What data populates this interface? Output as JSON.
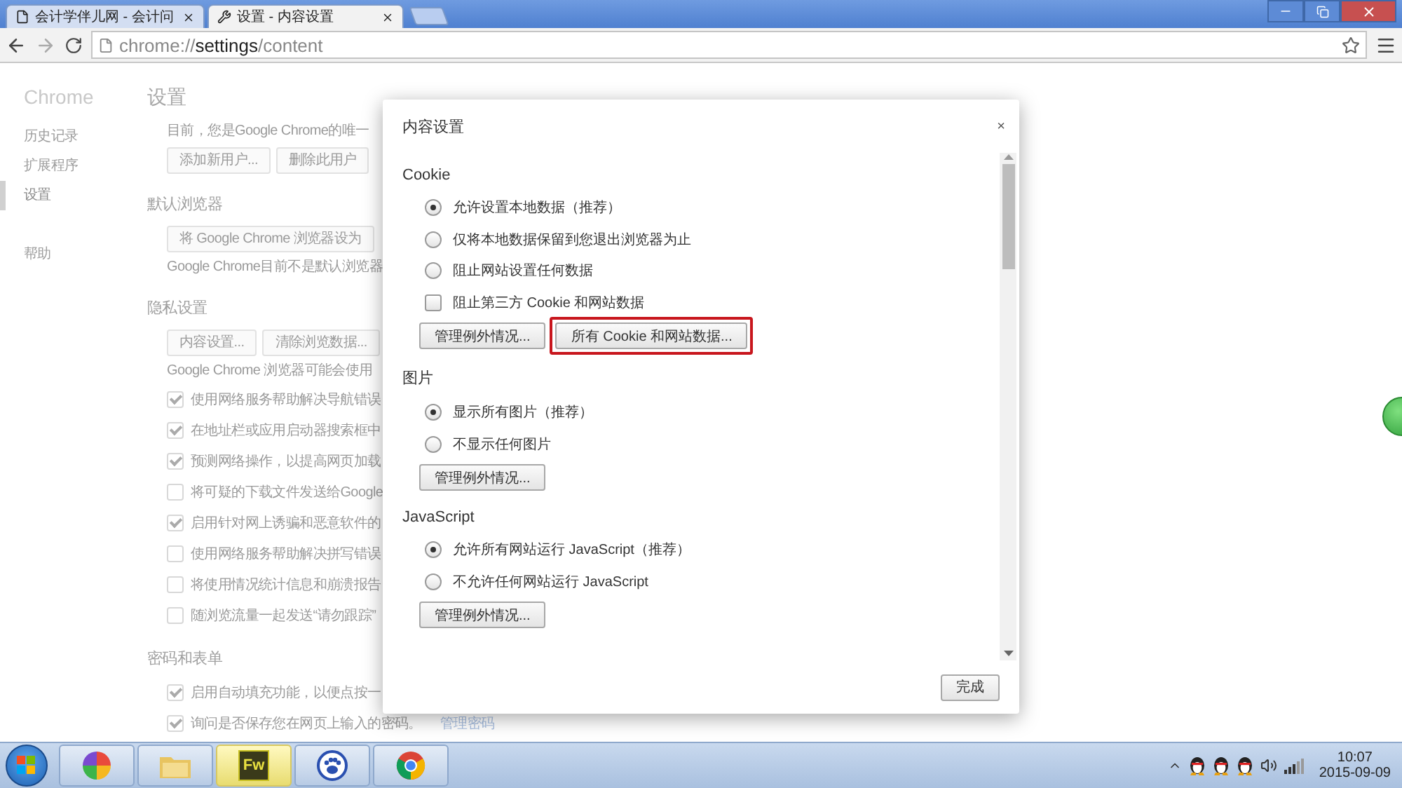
{
  "browser": {
    "tabs": [
      {
        "title": "会计学伴儿网 - 会计问",
        "selected": false,
        "kind": "page"
      },
      {
        "title": "设置 - 内容设置",
        "selected": true,
        "kind": "settings"
      }
    ],
    "address": {
      "scheme": "chrome://",
      "host": "settings",
      "path": "/content"
    }
  },
  "settings_page": {
    "sidebar": {
      "title": "Chrome",
      "groups": [
        [
          {
            "label": "历史记录",
            "selected": false
          },
          {
            "label": "扩展程序",
            "selected": false
          },
          {
            "label": "设置",
            "selected": true
          }
        ],
        [
          {
            "label": "帮助",
            "selected": false
          }
        ]
      ]
    },
    "heading": "设置",
    "sections": [
      {
        "items": [
          {
            "kind": "text",
            "text": "目前，您是Google Chrome的唯一"
          },
          {
            "kind": "buttons",
            "labels": [
              "添加新用户...",
              "删除此用户"
            ]
          }
        ]
      },
      {
        "title": "默认浏览器",
        "items": [
          {
            "kind": "buttons",
            "labels": [
              "将 Google Chrome 浏览器设为"
            ]
          },
          {
            "kind": "text",
            "text": "Google Chrome目前不是默认浏览器"
          }
        ]
      },
      {
        "title": "隐私设置",
        "items": [
          {
            "kind": "buttons",
            "labels": [
              "内容设置...",
              "清除浏览数据..."
            ]
          },
          {
            "kind": "text",
            "text": "Google Chrome 浏览器可能会使用"
          },
          {
            "kind": "checkbox",
            "label": "使用网络服务帮助解决导航错误",
            "checked": true
          },
          {
            "kind": "checkbox",
            "label": "在地址栏或应用启动器搜索框中",
            "checked": true
          },
          {
            "kind": "checkbox",
            "label": "预测网络操作，以提高网页加载",
            "checked": true
          },
          {
            "kind": "checkbox",
            "label": "将可疑的下载文件发送给Google",
            "checked": false
          },
          {
            "kind": "checkbox",
            "label": "启用针对网上诱骗和恶意软件的",
            "checked": true
          },
          {
            "kind": "checkbox",
            "label": "使用网络服务帮助解决拼写错误",
            "checked": false
          },
          {
            "kind": "checkbox",
            "label": "将使用情况统计信息和崩溃报告",
            "checked": false
          },
          {
            "kind": "checkbox",
            "label": "随浏览流量一起发送“请勿跟踪”",
            "checked": false
          }
        ]
      },
      {
        "title": "密码和表单",
        "items": [
          {
            "kind": "checkbox",
            "label": "启用自动填充功能，以便点按一",
            "checked": true
          },
          {
            "kind": "checkbox",
            "label": "询问是否保存您在网页上输入的密码。",
            "checked": true,
            "link": "管理密码"
          }
        ]
      }
    ]
  },
  "dialog": {
    "title": "内容设置",
    "close": "×",
    "sections": [
      {
        "title": "Cookie",
        "items": [
          {
            "kind": "radio",
            "label": "允许设置本地数据（推荐）",
            "selected": true
          },
          {
            "kind": "radio",
            "label": "仅将本地数据保留到您退出浏览器为止",
            "selected": false
          },
          {
            "kind": "radio",
            "label": "阻止网站设置任何数据",
            "selected": false
          },
          {
            "kind": "checkbox",
            "label": "阻止第三方 Cookie 和网站数据",
            "checked": false
          },
          {
            "kind": "buttons",
            "buttons": [
              {
                "label": "管理例外情况...",
                "highlighted": false
              },
              {
                "label": "所有 Cookie 和网站数据...",
                "highlighted": true
              }
            ]
          }
        ]
      },
      {
        "title": "图片",
        "items": [
          {
            "kind": "radio",
            "label": "显示所有图片（推荐）",
            "selected": true
          },
          {
            "kind": "radio",
            "label": "不显示任何图片",
            "selected": false
          },
          {
            "kind": "buttons",
            "buttons": [
              {
                "label": "管理例外情况...",
                "highlighted": false
              }
            ]
          }
        ]
      },
      {
        "title": "JavaScript",
        "items": [
          {
            "kind": "radio",
            "label": "允许所有网站运行 JavaScript（推荐）",
            "selected": true
          },
          {
            "kind": "radio",
            "label": "不允许任何网站运行 JavaScript",
            "selected": false
          },
          {
            "kind": "buttons",
            "buttons": [
              {
                "label": "管理例外情况...",
                "highlighted": false
              }
            ]
          }
        ]
      }
    ],
    "done": "完成"
  },
  "taskbar": {
    "apps": [
      {
        "kind": "pinwheel",
        "active": false
      },
      {
        "kind": "folder",
        "active": false
      },
      {
        "kind": "fw",
        "label": "Fw",
        "active": true
      },
      {
        "kind": "paw",
        "active": false
      },
      {
        "kind": "chrome",
        "active": false
      }
    ],
    "time": "10:07",
    "date": "2015-09-09"
  }
}
